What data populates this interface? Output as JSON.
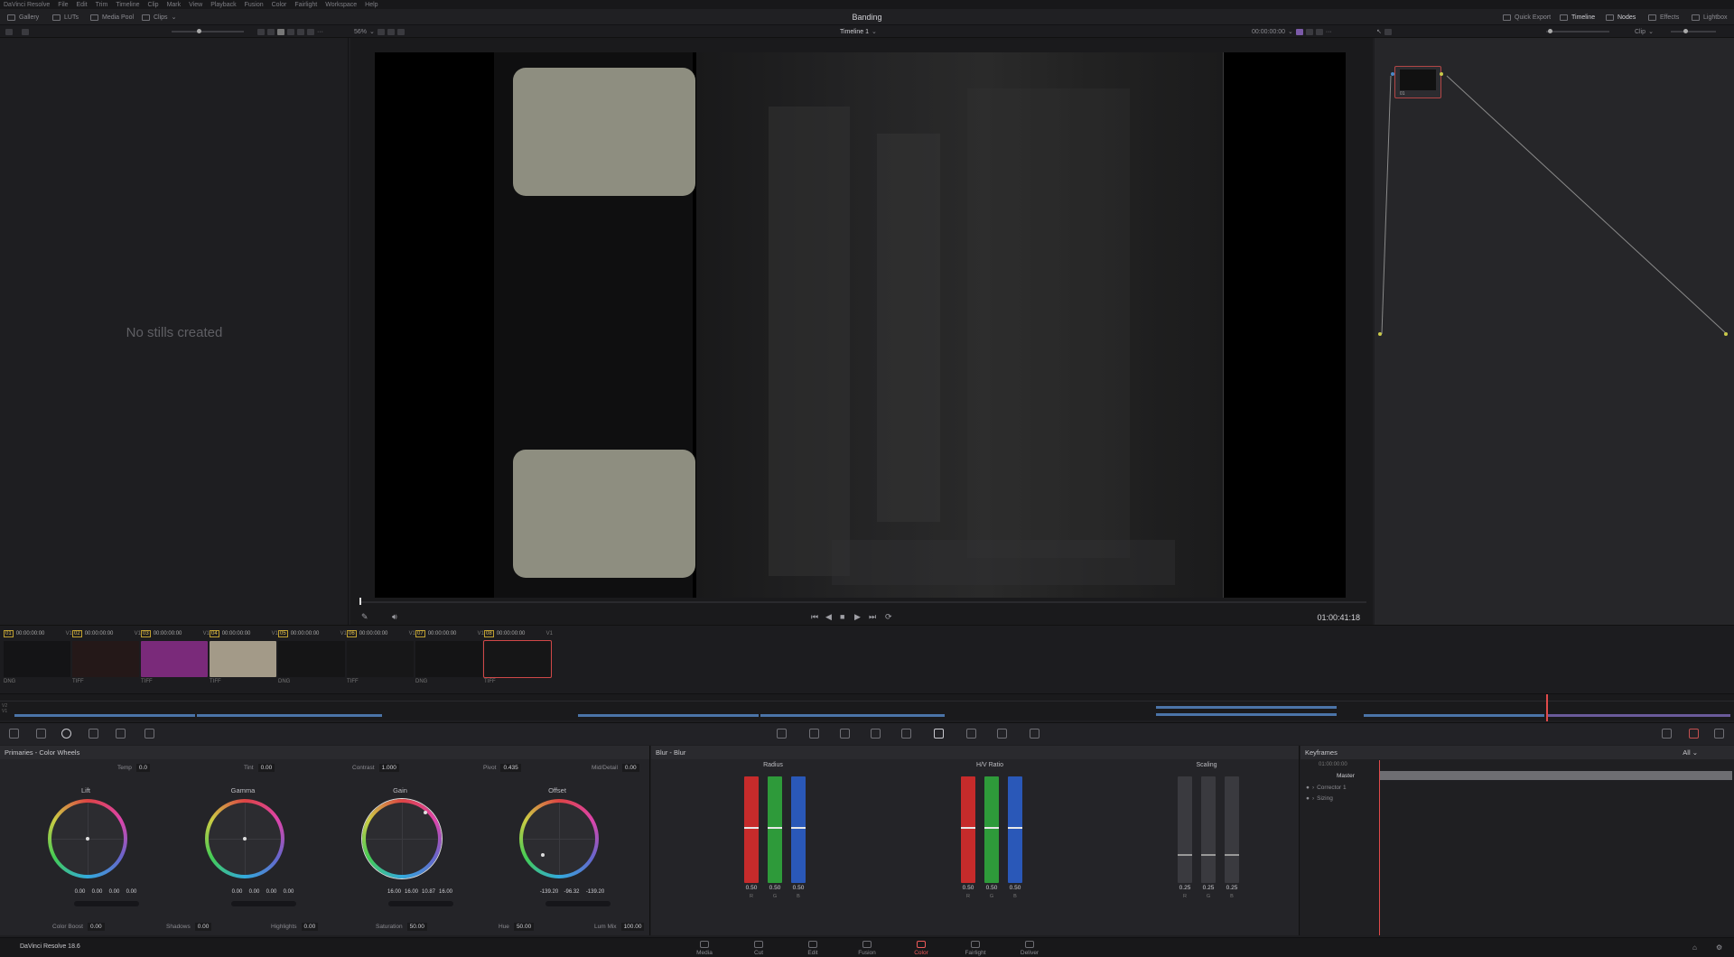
{
  "menu": [
    "DaVinci Resolve",
    "File",
    "Edit",
    "Trim",
    "Timeline",
    "Clip",
    "Mark",
    "View",
    "Playback",
    "Fusion",
    "Color",
    "Fairlight",
    "Workspace",
    "Help"
  ],
  "topbar": {
    "left_tabs": [
      "Gallery",
      "LUTs",
      "Media Pool",
      "Clips"
    ],
    "project_title": "Banding",
    "right_tabs": [
      "Quick Export",
      "Timeline",
      "Nodes",
      "Effects",
      "Lightbox"
    ]
  },
  "viewer": {
    "zoom": "56%",
    "timeline_name": "Timeline 1",
    "header_timecode": "00:00:00:00",
    "timecode": "01:00:41:18",
    "mode": "Clip"
  },
  "gallery": {
    "empty_message": "No stills created"
  },
  "node": {
    "label": "01"
  },
  "clips": [
    {
      "num": "01",
      "tc": "00:00:00:00",
      "track": "V1",
      "format": "DNG",
      "thumb": "#141416"
    },
    {
      "num": "02",
      "tc": "00:00:00:00",
      "track": "V1",
      "format": "TIFF",
      "thumb": "#241818"
    },
    {
      "num": "03",
      "tc": "00:00:00:00",
      "track": "V1",
      "format": "TIFF",
      "thumb": "#7a2a7a"
    },
    {
      "num": "04",
      "tc": "00:00:00:00",
      "track": "V1",
      "format": "TIFF",
      "thumb": "#a39a88"
    },
    {
      "num": "05",
      "tc": "00:00:00:00",
      "track": "V1",
      "format": "DNG",
      "thumb": "#151516"
    },
    {
      "num": "06",
      "tc": "00:00:00:00",
      "track": "V1",
      "format": "TIFF",
      "thumb": "#171718"
    },
    {
      "num": "07",
      "tc": "00:00:00:00",
      "track": "V1",
      "format": "DNG",
      "thumb": "#141415"
    },
    {
      "num": "08",
      "tc": "00:00:00:00",
      "track": "V1",
      "format": "TIFF",
      "thumb": "#161617"
    }
  ],
  "primaries": {
    "title": "Primaries - Color Wheels",
    "top": {
      "temp_label": "Temp",
      "temp": "0.0",
      "tint_label": "Tint",
      "tint": "0.00",
      "contrast_label": "Contrast",
      "contrast": "1.000",
      "pivot_label": "Pivot",
      "pivot": "0.435",
      "md_label": "Mid/Detail",
      "md": "0.00"
    },
    "wheels": [
      {
        "name": "Lift",
        "vals": [
          "0.00",
          "0.00",
          "0.00",
          "0.00"
        ]
      },
      {
        "name": "Gamma",
        "vals": [
          "0.00",
          "0.00",
          "0.00",
          "0.00"
        ]
      },
      {
        "name": "Gain",
        "vals": [
          "16.00",
          "16.00",
          "10.87",
          "16.00"
        ]
      },
      {
        "name": "Offset",
        "vals": [
          "-139.20",
          "-96.32",
          "-139.20",
          ""
        ]
      }
    ],
    "bottom": {
      "cb_label": "Color Boost",
      "cb": "0.00",
      "sh_label": "Shadows",
      "sh": "0.00",
      "hl_label": "Highlights",
      "hl": "0.00",
      "sat_label": "Saturation",
      "sat": "50.00",
      "hue_label": "Hue",
      "hue": "50.00",
      "lm_label": "Lum Mix",
      "lm": "100.00"
    }
  },
  "blur": {
    "title": "Blur - Blur",
    "groups": [
      {
        "name": "Radius",
        "vals": [
          "0.50",
          "0.50",
          "0.50"
        ],
        "channels": [
          "R",
          "G",
          "B"
        ]
      },
      {
        "name": "H/V Ratio",
        "vals": [
          "0.50",
          "0.50",
          "0.50"
        ],
        "channels": [
          "R",
          "G",
          "B"
        ]
      },
      {
        "name": "Scaling",
        "vals": [
          "0.25",
          "0.25",
          "0.25"
        ],
        "channels": [
          "R",
          "G",
          "B"
        ]
      }
    ]
  },
  "keyframes": {
    "title": "Keyframes",
    "filter": "All",
    "timecode": "01:00:00:00",
    "rows": [
      "Master",
      "Corrector 1",
      "Sizing"
    ]
  },
  "footer": {
    "app_name": "DaVinci Resolve 18.6",
    "pages": [
      "Media",
      "Cut",
      "Edit",
      "Fusion",
      "Color",
      "Fairlight",
      "Deliver"
    ],
    "active_page": "Color"
  }
}
